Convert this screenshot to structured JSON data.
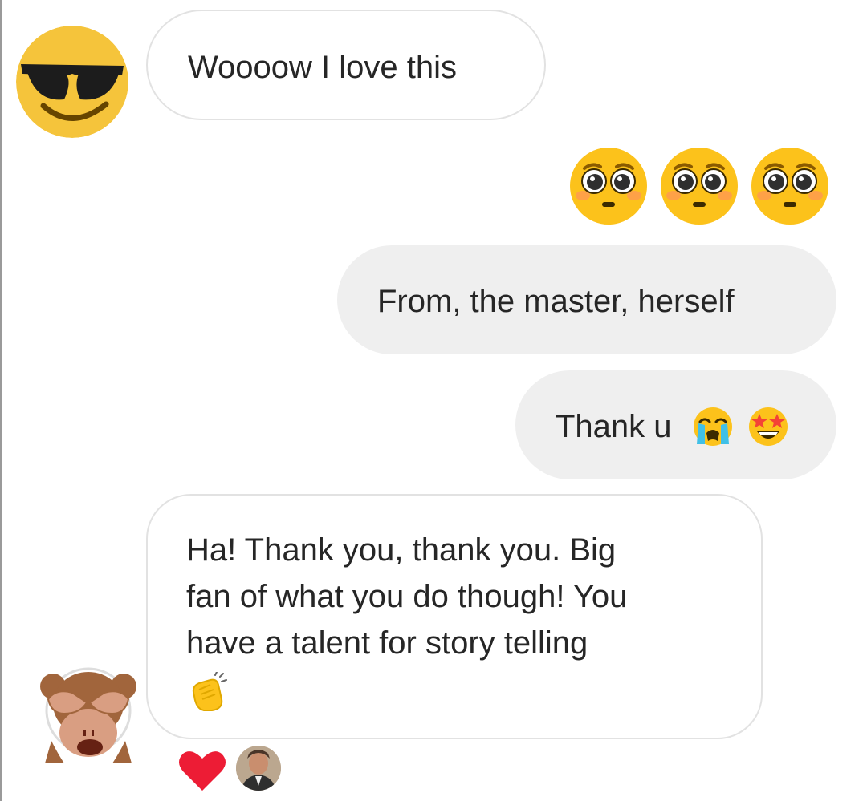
{
  "conversation": {
    "messages": [
      {
        "sender": "them",
        "text": "Woooow I love this"
      },
      {
        "sender": "me",
        "type": "emoji",
        "emojis": [
          "pleading-face-emoji",
          "pleading-face-emoji",
          "pleading-face-emoji"
        ]
      },
      {
        "sender": "me",
        "text": "From, the master, herself"
      },
      {
        "sender": "me",
        "text": "Thank u",
        "emojis": [
          "loudly-crying-face-emoji",
          "star-struck-emoji"
        ]
      },
      {
        "sender": "them",
        "lines": [
          "Ha! Thank you, thank you. Big",
          "fan of what you do though! You",
          "have a talent for story telling"
        ],
        "emojis": [
          "clapping-hands-emoji"
        ]
      }
    ],
    "reactions": {
      "items": [
        "red-heart-emoji"
      ],
      "reactor_avatar": "user-photo-avatar"
    },
    "avatars": {
      "first": "smiling-face-with-sunglasses",
      "second": "see-no-evil-monkey"
    }
  },
  "colors": {
    "incoming_bubble_bg": "#ffffff",
    "incoming_bubble_border": "#e2e2e2",
    "outgoing_bubble_bg": "#efefef",
    "text": "#262626"
  }
}
